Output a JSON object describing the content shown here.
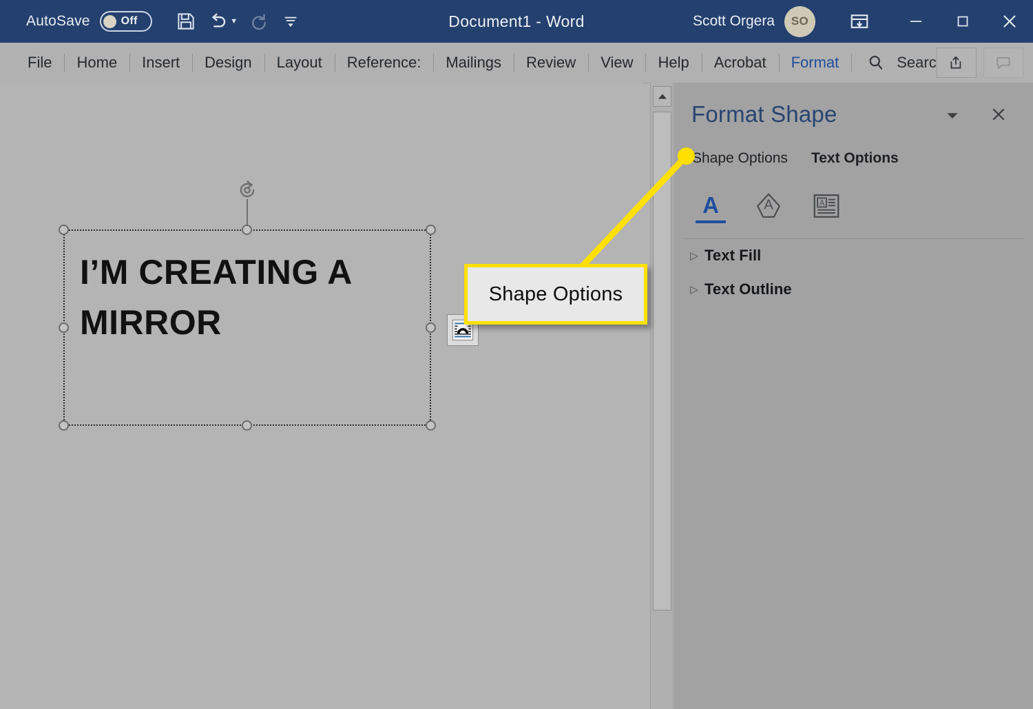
{
  "titlebar": {
    "autosave_label": "AutoSave",
    "autosave_state": "Off",
    "save_icon": "save-icon",
    "undo_icon": "undo-icon",
    "redo_icon": "redo-icon",
    "customize_qat_icon": "customize-quick-access-toolbar-icon",
    "document_title": "Document1  -  Word",
    "user_name": "Scott Orgera",
    "avatar_initials": "SO",
    "ribbon_display_icon": "ribbon-display-options-icon",
    "minimize_icon": "minimize-icon",
    "maximize_icon": "maximize-icon",
    "close_icon": "close-icon",
    "background_color": "#24406e"
  },
  "ribbon": {
    "tabs": [
      {
        "label": "File",
        "accent": false
      },
      {
        "label": "Home",
        "accent": false
      },
      {
        "label": "Insert",
        "accent": false
      },
      {
        "label": "Design",
        "accent": false
      },
      {
        "label": "Layout",
        "accent": false
      },
      {
        "label": "Reference:",
        "accent": false
      },
      {
        "label": "Mailings",
        "accent": false
      },
      {
        "label": "Review",
        "accent": false
      },
      {
        "label": "View",
        "accent": false
      },
      {
        "label": "Help",
        "accent": false
      },
      {
        "label": "Acrobat",
        "accent": false
      },
      {
        "label": "Format",
        "accent": true
      }
    ],
    "search_label": "Search",
    "search_icon": "search-icon",
    "share_icon": "share-icon",
    "comments_icon": "comments-icon",
    "accent_color": "#1f4e9c",
    "background_color": "#b1b1b1"
  },
  "document": {
    "background_color": "#b4b4b4",
    "textbox": {
      "text": "I’M CREATING A MIRROR",
      "rotate_handle_icon": "rotate-handle-icon",
      "layout_options_icon": "layout-options-icon"
    },
    "scrollbar": {
      "up_arrow_icon": "scroll-up-arrow-icon"
    }
  },
  "format_pane": {
    "title": "Format Shape",
    "dropdown_icon": "chevron-down-icon",
    "close_icon": "close-icon",
    "tabs": [
      {
        "label": "Shape Options",
        "selected": true
      },
      {
        "label": "Text Options",
        "selected": false
      }
    ],
    "icons": [
      {
        "name": "text-fill-and-outline-icon",
        "selected": true
      },
      {
        "name": "text-effects-icon",
        "selected": false
      },
      {
        "name": "textbox-icon",
        "selected": false
      }
    ],
    "sections": [
      {
        "label": "Text Fill",
        "expanded": false,
        "triangle": "▷"
      },
      {
        "label": "Text Outline",
        "expanded": false,
        "triangle": "▷"
      }
    ],
    "title_color": "#274472",
    "background_color": "#a2a2a2"
  },
  "annotation": {
    "callout_label": "Shape Options",
    "highlight_color": "#ffe000",
    "box_fill": "#e8e8e8"
  }
}
